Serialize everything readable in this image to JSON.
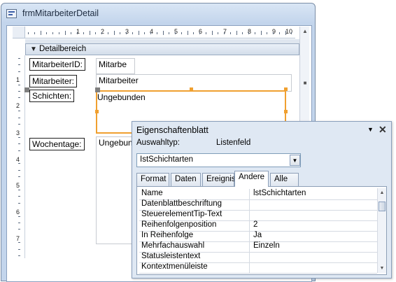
{
  "form_window": {
    "title": "frmMitarbeiterDetail",
    "ruler_numbers": [
      "1",
      "2",
      "3",
      "4",
      "5",
      "6",
      "7",
      "8",
      "9",
      "10"
    ],
    "left_ruler_numbers": [
      "1",
      "2",
      "3",
      "4",
      "5",
      "6",
      "7"
    ],
    "section_label": "Detailbereich"
  },
  "form_controls": {
    "labels": {
      "mitarbeiter_id": "MitarbeiterID:",
      "mitarbeiter": "Mitarbeiter:",
      "schichten": "Schichten:",
      "wochentage": "Wochentage:"
    },
    "fields": {
      "mitarbeiter_id": "Mitarbe",
      "mitarbeiter": "Mitarbeiter",
      "schichten": "Ungebunden",
      "wochentage": "Ungebunde"
    }
  },
  "property_sheet": {
    "title": "Eigenschaftenblatt",
    "selection_type_label": "Auswahltyp:",
    "selection_type_value": "Listenfeld",
    "object_selector": "IstSchichtarten",
    "tabs": [
      "Format",
      "Daten",
      "Ereignis",
      "Andere",
      "Alle"
    ],
    "active_tab": "Andere",
    "rows": [
      {
        "name": "Name",
        "value": "lstSchichtarten"
      },
      {
        "name": "Datenblattbeschriftung",
        "value": ""
      },
      {
        "name": "SteuerelementTip-Text",
        "value": ""
      },
      {
        "name": "Reihenfolgenposition",
        "value": "2"
      },
      {
        "name": "In Reihenfolge",
        "value": "Ja"
      },
      {
        "name": "Mehrfachauswahl",
        "value": "Einzeln"
      },
      {
        "name": "Statusleistentext",
        "value": ""
      },
      {
        "name": "Kontextmenüleiste",
        "value": ""
      }
    ]
  },
  "colors": {
    "selection_accent": "#f0a030",
    "window_frame": "#c3d5ec"
  }
}
